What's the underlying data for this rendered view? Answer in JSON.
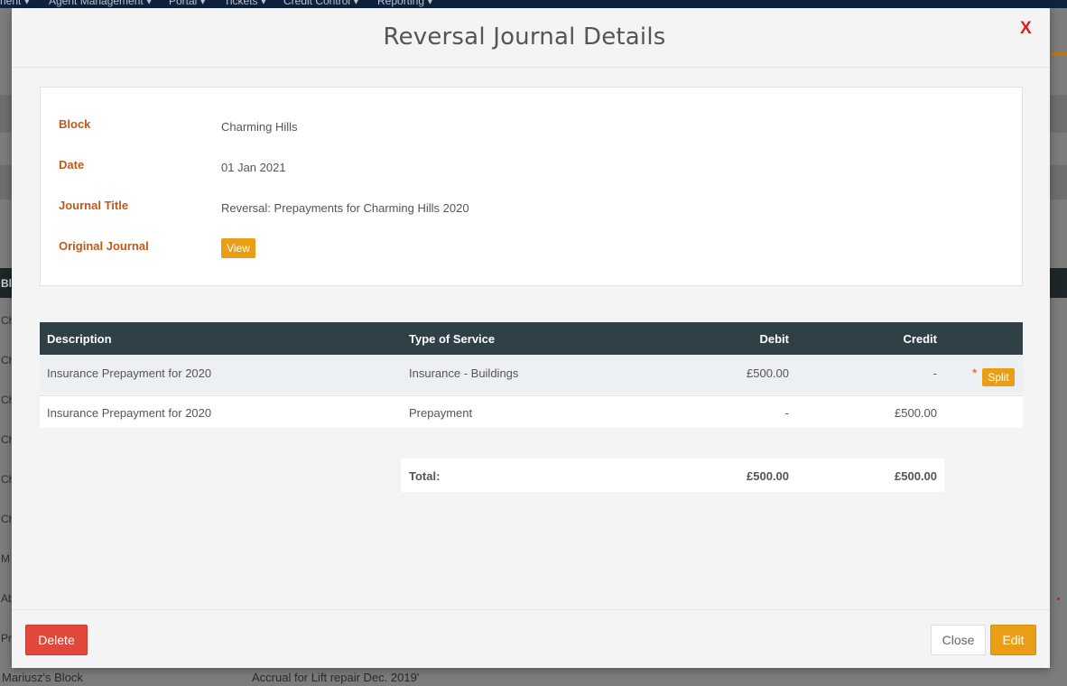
{
  "background": {
    "nav_items": [
      "nent ▾",
      "Agent Management ▾",
      "Portal ▾",
      "Tickets ▾",
      "Credit Control ▾",
      "Reporting ▾"
    ],
    "left_rows": [
      "Bl",
      "Ch",
      "Ch",
      "Ch",
      "Ch",
      "Ch",
      "Ch",
      "M",
      "Ab",
      "Pr"
    ],
    "bottom_row": {
      "block": "Mariusz's Block",
      "title": "Accrual for Lift repair Dec. 2019'"
    }
  },
  "modal": {
    "title": "Reversal Journal Details",
    "close_glyph": "X",
    "details": {
      "block_label": "Block",
      "block_value": "Charming Hills",
      "date_label": "Date",
      "date_value": "01 Jan 2021",
      "journal_title_label": "Journal Title",
      "journal_title_value": "Reversal: Prepayments for Charming Hills 2020",
      "original_journal_label": "Original Journal",
      "view_label": "View"
    },
    "table": {
      "headers": {
        "description": "Description",
        "type_of_service": "Type of Service",
        "debit": "Debit",
        "credit": "Credit"
      },
      "rows": [
        {
          "description": "Insurance Prepayment for 2020",
          "type_of_service": "Insurance - Buildings",
          "debit": "£500.00",
          "credit": "-",
          "marker": "*",
          "split_label": "Split"
        },
        {
          "description": "Insurance Prepayment for 2020",
          "type_of_service": "Prepayment",
          "debit": "-",
          "credit": "£500.00"
        }
      ],
      "total": {
        "label": "Total:",
        "debit": "£500.00",
        "credit": "£500.00"
      }
    },
    "footer": {
      "delete_label": "Delete",
      "close_label": "Close",
      "edit_label": "Edit"
    }
  },
  "colors": {
    "accent_orange": "#e99e16",
    "label_orange": "#c2581a",
    "danger_red": "#e2473c",
    "table_header": "#2f4147",
    "close_x_red": "#e11d1d"
  }
}
